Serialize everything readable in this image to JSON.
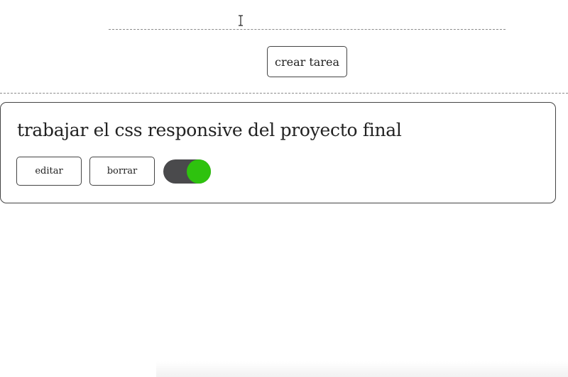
{
  "new_task": {
    "input_value": "",
    "create_label": "crear tarea"
  },
  "tasks": [
    {
      "text": "trabajar el css responsive del proyecto final",
      "edit_label": "editar",
      "delete_label": "borrar",
      "done": true
    }
  ],
  "colors": {
    "toggle_track": "#4a4a4c",
    "toggle_knob_on": "#2ec20e"
  },
  "icons": {
    "cursor": "text-cursor-icon"
  }
}
